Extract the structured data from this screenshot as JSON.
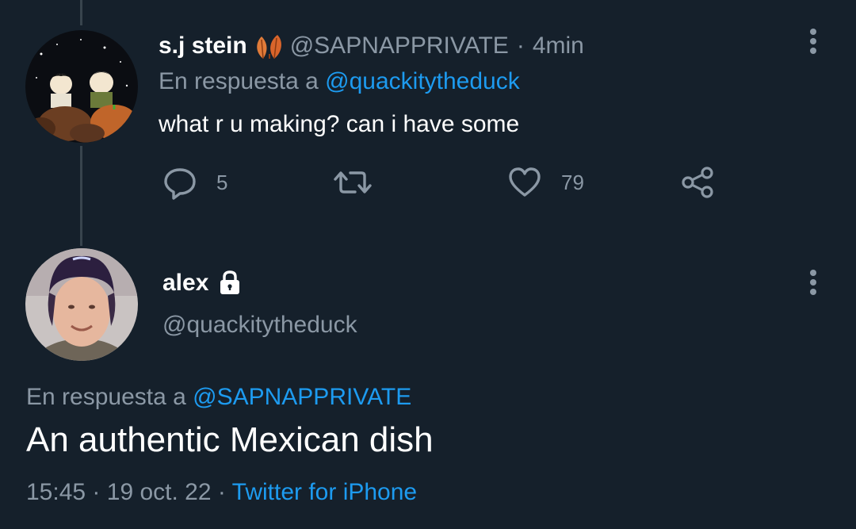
{
  "colors": {
    "background": "#15202b",
    "muted": "#8b98a5",
    "link": "#1d9bf0",
    "thread_line": "#38444d"
  },
  "reply_tweet": {
    "display_name": "s.j stein",
    "name_icon": "autumn-leaves-icon",
    "handle": "@SAPNAPPRIVATE",
    "separator": "·",
    "time_ago": "4min",
    "replying_to_label": "En respuesta a",
    "replying_to_handle": "@quackitytheduck",
    "text": "what r u making? can i have some",
    "actions": {
      "reply_count": "5",
      "retweet_count": "",
      "like_count": "79"
    }
  },
  "main_tweet": {
    "display_name": "alex",
    "name_icon": "lock-icon",
    "handle": "@quackitytheduck",
    "replying_to_label": "En respuesta a",
    "replying_to_handle": "@SAPNAPPRIVATE",
    "text": "An authentic Mexican dish",
    "time": "15:45",
    "separator": "·",
    "date": "19 oct. 22",
    "source": "Twitter for iPhone"
  }
}
